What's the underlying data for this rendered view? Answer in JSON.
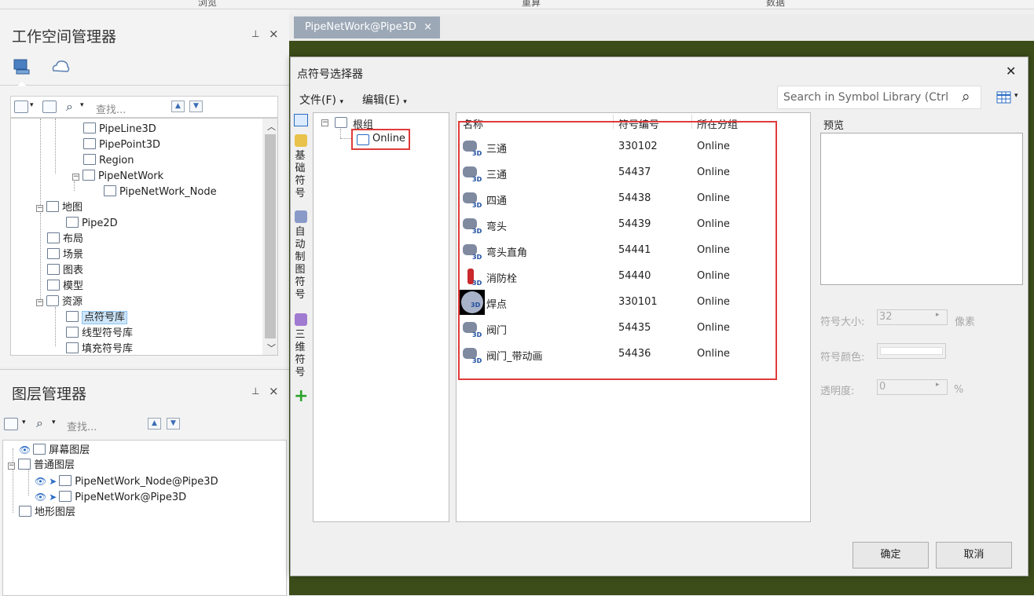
{
  "ribbon": {
    "labels": [
      "浏览",
      "重算",
      "数据"
    ]
  },
  "workspace": {
    "title": "工作空间管理器",
    "pin": "📌",
    "close": "×",
    "search_placeholder": "查找...",
    "tree": [
      {
        "label": "PipeLine3D",
        "indent": 1,
        "icon": "line3d-icon"
      },
      {
        "label": "PipePoint3D",
        "indent": 1,
        "icon": "point3d-icon"
      },
      {
        "label": "Region",
        "indent": 1,
        "icon": "region-icon"
      },
      {
        "label": "PipeNetWork",
        "indent": 1,
        "icon": "network-icon"
      },
      {
        "label": "PipeNetWork_Node",
        "indent": 2,
        "icon": "point3d-icon"
      },
      {
        "label": "地图",
        "indent": 0,
        "icon": "map-icon"
      },
      {
        "label": "Pipe2D",
        "indent": 1,
        "icon": "map-icon"
      },
      {
        "label": "布局",
        "indent": 0,
        "icon": "layout-icon"
      },
      {
        "label": "场景",
        "indent": 0,
        "icon": "scene-icon"
      },
      {
        "label": "图表",
        "indent": 0,
        "icon": "chart-icon"
      },
      {
        "label": "模型",
        "indent": 0,
        "icon": "model-icon"
      },
      {
        "label": "资源",
        "indent": 0,
        "icon": "folder-icon"
      },
      {
        "label": "点符号库",
        "indent": 1,
        "icon": "point-symbol-icon",
        "selected": true
      },
      {
        "label": "线型符号库",
        "indent": 1,
        "icon": "line-symbol-icon"
      },
      {
        "label": "填充符号库",
        "indent": 1,
        "icon": "fill-symbol-icon"
      }
    ]
  },
  "layers": {
    "title": "图层管理器",
    "search_placeholder": "查找...",
    "rows": [
      {
        "label": "屏幕图层",
        "indent": 0
      },
      {
        "label": "普通图层",
        "indent": 0
      },
      {
        "label": "PipeNetWork_Node@Pipe3D",
        "indent": 1
      },
      {
        "label": "PipeNetWork@Pipe3D",
        "indent": 1
      },
      {
        "label": "地形图层",
        "indent": 0
      }
    ]
  },
  "map_tab": {
    "label": "PipeNetWork@Pipe3D",
    "close": "×"
  },
  "dialog": {
    "title": "点符号选择器",
    "close": "✕",
    "menu_file": "文件(F)",
    "menu_edit": "编辑(E)",
    "search_placeholder": "Search in Symbol Library (Ctrl",
    "vtabs": [
      "基础符号",
      "自动制图符号",
      "三维符号"
    ],
    "tree_root": "根组",
    "tree_child": "Online",
    "columns": {
      "name": "名称",
      "code": "符号编号",
      "group": "所在分组"
    },
    "symbols": [
      {
        "name": "三通",
        "code": "330102",
        "group": "Online"
      },
      {
        "name": "三通",
        "code": "54437",
        "group": "Online"
      },
      {
        "name": "四通",
        "code": "54438",
        "group": "Online"
      },
      {
        "name": "弯头",
        "code": "54439",
        "group": "Online"
      },
      {
        "name": "弯头直角",
        "code": "54441",
        "group": "Online"
      },
      {
        "name": "消防栓",
        "code": "54440",
        "group": "Online"
      },
      {
        "name": "焊点",
        "code": "330101",
        "group": "Online"
      },
      {
        "name": "阀门",
        "code": "54435",
        "group": "Online"
      },
      {
        "name": "阀门_带动画",
        "code": "54436",
        "group": "Online"
      }
    ],
    "symbol_badge": "3D",
    "preview_label": "预览",
    "size_label": "符号大小:",
    "size_value": "32",
    "size_unit": "像素",
    "color_label": "符号颜色:",
    "opacity_label": "透明度:",
    "opacity_value": "0",
    "opacity_unit": "%",
    "ok": "确定",
    "cancel": "取消"
  },
  "colors": {
    "highlight_box": "#e03b3b",
    "map_bg": "#3c4d1a",
    "selection": "#cde6fb"
  }
}
